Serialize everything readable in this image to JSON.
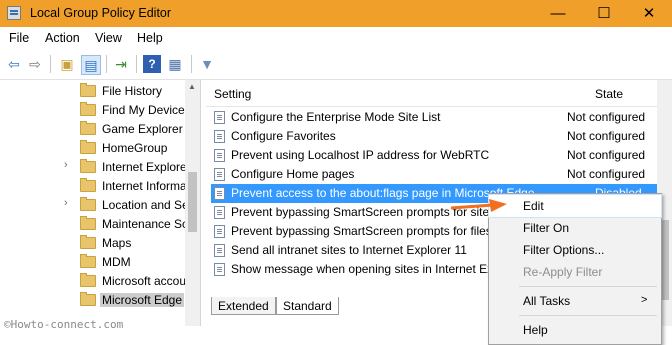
{
  "window": {
    "title": "Local Group Policy Editor",
    "minimize": "—",
    "maximize": "☐",
    "close": "✕"
  },
  "menu": [
    "File",
    "Action",
    "View",
    "Help"
  ],
  "toolbar": {
    "icons": [
      "back-arrow-icon",
      "forward-arrow-icon",
      "folder-up-icon",
      "show-hide-tree-icon",
      "export-list-icon",
      "help-icon",
      "properties-icon",
      "filter-icon"
    ],
    "glyphs": {
      "back": "⇦",
      "forward": "⇨",
      "up": "▣",
      "tree": "▤",
      "export": "⇥",
      "help": "?",
      "props": "▦",
      "filter": "▼"
    }
  },
  "tree": {
    "items": [
      {
        "label": "File History",
        "expandable": false,
        "selected": false
      },
      {
        "label": "Find My Device",
        "expandable": false,
        "selected": false
      },
      {
        "label": "Game Explorer",
        "expandable": false,
        "selected": false
      },
      {
        "label": "HomeGroup",
        "expandable": false,
        "selected": false
      },
      {
        "label": "Internet Explore",
        "expandable": true,
        "selected": false
      },
      {
        "label": "Internet Informa",
        "expandable": false,
        "selected": false
      },
      {
        "label": "Location and Se",
        "expandable": true,
        "selected": false
      },
      {
        "label": "Maintenance Sc",
        "expandable": false,
        "selected": false
      },
      {
        "label": "Maps",
        "expandable": false,
        "selected": false
      },
      {
        "label": "MDM",
        "expandable": false,
        "selected": false
      },
      {
        "label": "Microsoft accou",
        "expandable": false,
        "selected": false
      },
      {
        "label": "Microsoft Edge",
        "expandable": false,
        "selected": true
      }
    ],
    "expander_glyph": "›"
  },
  "list": {
    "header": {
      "setting": "Setting",
      "state": "State"
    },
    "rows": [
      {
        "label": "Configure the Enterprise Mode Site List",
        "state": "Not configured",
        "selected": false
      },
      {
        "label": "Configure Favorites",
        "state": "Not configured",
        "selected": false
      },
      {
        "label": "Prevent using Localhost IP address for WebRTC",
        "state": "Not configured",
        "selected": false
      },
      {
        "label": "Configure Home pages",
        "state": "Not configured",
        "selected": false
      },
      {
        "label": "Prevent access to the about:flags page in Microsoft Edge",
        "state": "Disabled",
        "selected": true
      },
      {
        "label": "Prevent bypassing SmartScreen prompts for sites",
        "state": "",
        "selected": false
      },
      {
        "label": "Prevent bypassing SmartScreen prompts for files",
        "state": "",
        "selected": false
      },
      {
        "label": "Send all intranet sites to Internet Explorer 11",
        "state": "",
        "selected": false
      },
      {
        "label": "Show message when opening sites in Internet Exp",
        "state": "",
        "selected": false
      }
    ]
  },
  "tabs": [
    "Extended",
    "Standard"
  ],
  "context_menu": {
    "items": [
      {
        "label": "Edit",
        "disabled": false,
        "submenu": false
      },
      {
        "label": "Filter On",
        "disabled": false,
        "submenu": false
      },
      {
        "label": "Filter Options...",
        "disabled": false,
        "submenu": false
      },
      {
        "label": "Re-Apply Filter",
        "disabled": true,
        "submenu": false
      },
      {
        "label": "All Tasks",
        "disabled": false,
        "submenu": true
      },
      {
        "label": "Help",
        "disabled": false,
        "submenu": false
      }
    ],
    "submenu_glyph": ">"
  },
  "watermark": "©Howto-connect.com",
  "colors": {
    "titlebar": "#f0a02a",
    "selection": "#3399ff",
    "callout_arrow": "#f07020"
  }
}
